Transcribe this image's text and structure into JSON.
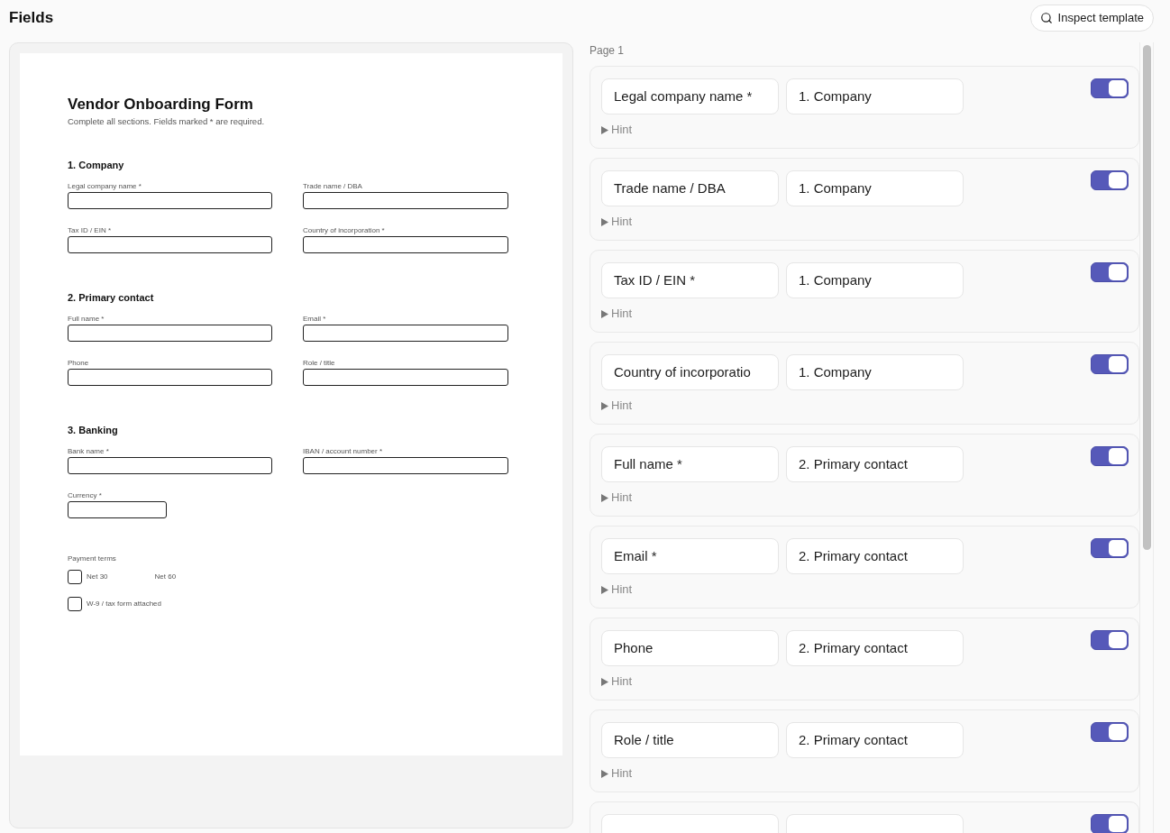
{
  "header": {
    "title": "Fields",
    "inspect_button": "Inspect template"
  },
  "preview": {
    "title": "Vendor Onboarding Form",
    "subtitle": "Complete all sections. Fields marked * are required.",
    "sections": [
      {
        "heading": "1. Company",
        "fields": [
          {
            "label": "Legal company name *",
            "kind": "text"
          },
          {
            "label": "Trade name / DBA",
            "kind": "text"
          },
          {
            "label": "Tax ID / EIN *",
            "kind": "text"
          },
          {
            "label": "Country of incorporation *",
            "kind": "text"
          }
        ]
      },
      {
        "heading": "2. Primary contact",
        "fields": [
          {
            "label": "Full name *",
            "kind": "text"
          },
          {
            "label": "Email *",
            "kind": "text"
          },
          {
            "label": "Phone",
            "kind": "text"
          },
          {
            "label": "Role / title",
            "kind": "text"
          }
        ]
      },
      {
        "heading": "3. Banking",
        "fields": [
          {
            "label": "Bank name *",
            "kind": "text"
          },
          {
            "label": "IBAN / account number *",
            "kind": "text"
          },
          {
            "label": "Currency *",
            "kind": "short"
          }
        ]
      }
    ],
    "payment_terms": {
      "label": "Payment terms",
      "options": [
        {
          "label": "Net 30",
          "kind": "checkbox",
          "checked": false
        },
        {
          "label": "Net 60",
          "kind": "text"
        }
      ]
    },
    "attachments": [
      {
        "label": "W-9 / tax form attached",
        "checked": false
      }
    ]
  },
  "field_list": {
    "page_label": "Page 1",
    "fields": [
      {
        "label": "Legal company name *",
        "section": "1. Company",
        "enabled": true,
        "hint_expanded": false,
        "hint_label": "Hint"
      },
      {
        "label": "Trade name / DBA",
        "section": "1. Company",
        "enabled": true,
        "hint_expanded": false,
        "hint_label": "Hint"
      },
      {
        "label": "Tax ID / EIN *",
        "section": "1. Company",
        "enabled": true,
        "hint_expanded": false,
        "hint_label": "Hint"
      },
      {
        "label": "Country of incorporatio",
        "section": "1. Company",
        "enabled": true,
        "hint_expanded": false,
        "hint_label": "Hint"
      },
      {
        "label": "Full name *",
        "section": "2. Primary contact",
        "enabled": true,
        "hint_expanded": false,
        "hint_label": "Hint"
      },
      {
        "label": "Email *",
        "section": "2. Primary contact",
        "enabled": true,
        "hint_expanded": false,
        "hint_label": "Hint"
      },
      {
        "label": "Phone",
        "section": "2. Primary contact",
        "enabled": true,
        "hint_expanded": false,
        "hint_label": "Hint"
      },
      {
        "label": "Role / title",
        "section": "2. Primary contact",
        "enabled": true,
        "hint_expanded": false,
        "hint_label": "Hint"
      },
      {
        "enabled": true
      }
    ]
  }
}
